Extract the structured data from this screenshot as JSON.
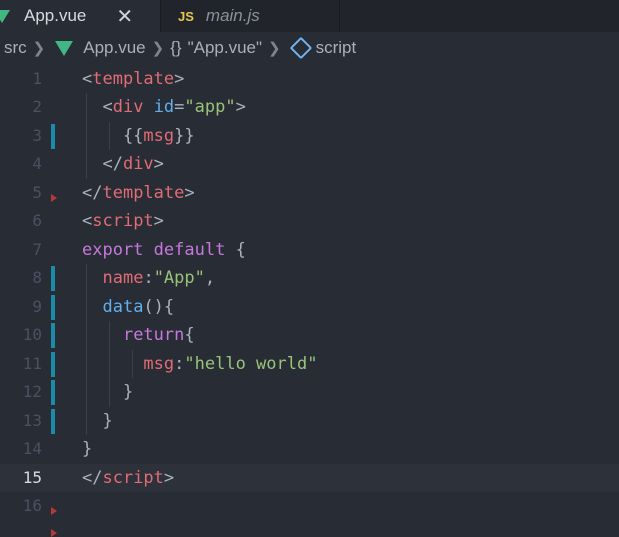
{
  "tabs": [
    {
      "label": "App.vue",
      "icon": "vue-icon",
      "active": true
    },
    {
      "label": "main.js",
      "icon": "js-icon",
      "badge": "JS",
      "active": false
    }
  ],
  "breadcrumb": {
    "folder": "src",
    "file": "App.vue",
    "symbol_braces": "{}",
    "symbol_name": "\"App.vue\"",
    "section": "script"
  },
  "editor": {
    "active_line": 15,
    "lines": [
      {
        "n": "1",
        "tokens": [
          [
            "t-punct",
            "<"
          ],
          [
            "t-tag",
            "template"
          ],
          [
            "t-punct",
            ">"
          ]
        ]
      },
      {
        "n": "2",
        "tokens": [
          [
            "t-punct",
            "  <"
          ],
          [
            "t-tag",
            "div"
          ],
          [
            "t-punct",
            " "
          ],
          [
            "t-attr",
            "id"
          ],
          [
            "t-punct",
            "="
          ],
          [
            "t-str",
            "\"app\""
          ],
          [
            "t-punct",
            ">"
          ]
        ]
      },
      {
        "n": "3",
        "tokens": [
          [
            "t-punct",
            "    {{"
          ],
          [
            "t-prop",
            "msg"
          ],
          [
            "t-punct",
            "}}"
          ]
        ]
      },
      {
        "n": "4",
        "tokens": [
          [
            "t-punct",
            "  </"
          ],
          [
            "t-tag",
            "div"
          ],
          [
            "t-punct",
            ">"
          ]
        ]
      },
      {
        "n": "5",
        "tokens": [
          [
            "t-punct",
            "</"
          ],
          [
            "t-tag",
            "template"
          ],
          [
            "t-punct",
            ">"
          ]
        ]
      },
      {
        "n": "6",
        "tokens": [
          [
            "t-punct",
            "<"
          ],
          [
            "t-tag",
            "script"
          ],
          [
            "t-punct",
            ">"
          ]
        ]
      },
      {
        "n": "7",
        "tokens": [
          [
            "t-kw",
            "export"
          ],
          [
            "t-punct",
            " "
          ],
          [
            "t-kw",
            "default"
          ],
          [
            "t-punct",
            " {"
          ]
        ]
      },
      {
        "n": "8",
        "tokens": [
          [
            "t-punct",
            "  "
          ],
          [
            "t-prop",
            "name"
          ],
          [
            "t-punct",
            ":"
          ],
          [
            "t-str",
            "\"App\""
          ],
          [
            "t-punct",
            ","
          ]
        ]
      },
      {
        "n": "9",
        "tokens": [
          [
            "t-punct",
            "  "
          ],
          [
            "t-fn",
            "data"
          ],
          [
            "t-punct",
            "(){"
          ]
        ]
      },
      {
        "n": "10",
        "tokens": [
          [
            "t-punct",
            "    "
          ],
          [
            "t-kw",
            "return"
          ],
          [
            "t-punct",
            "{"
          ]
        ]
      },
      {
        "n": "11",
        "tokens": [
          [
            "t-punct",
            "      "
          ],
          [
            "t-prop",
            "msg"
          ],
          [
            "t-punct",
            ":"
          ],
          [
            "t-str",
            "\"hello world\""
          ]
        ]
      },
      {
        "n": "12",
        "tokens": [
          [
            "t-punct",
            "    }"
          ]
        ]
      },
      {
        "n": "13",
        "tokens": [
          [
            "t-punct",
            "  }"
          ]
        ]
      },
      {
        "n": "14",
        "tokens": [
          [
            "t-punct",
            "}"
          ]
        ]
      },
      {
        "n": "15",
        "tokens": [
          [
            "t-punct",
            "</"
          ],
          [
            "t-tag",
            "script"
          ],
          [
            "t-punct",
            ">"
          ]
        ]
      },
      {
        "n": "16",
        "tokens": []
      }
    ],
    "modified_lines": [
      3,
      8,
      9,
      10,
      11,
      12,
      13
    ],
    "fold_markers": [
      6,
      17
    ]
  },
  "colors": {
    "background": "#282c34",
    "tag": "#e06c75",
    "string": "#98c379",
    "keyword": "#c678dd",
    "function": "#61afef",
    "modified_marker": "#1b8ba8",
    "vue_green": "#41b883"
  }
}
